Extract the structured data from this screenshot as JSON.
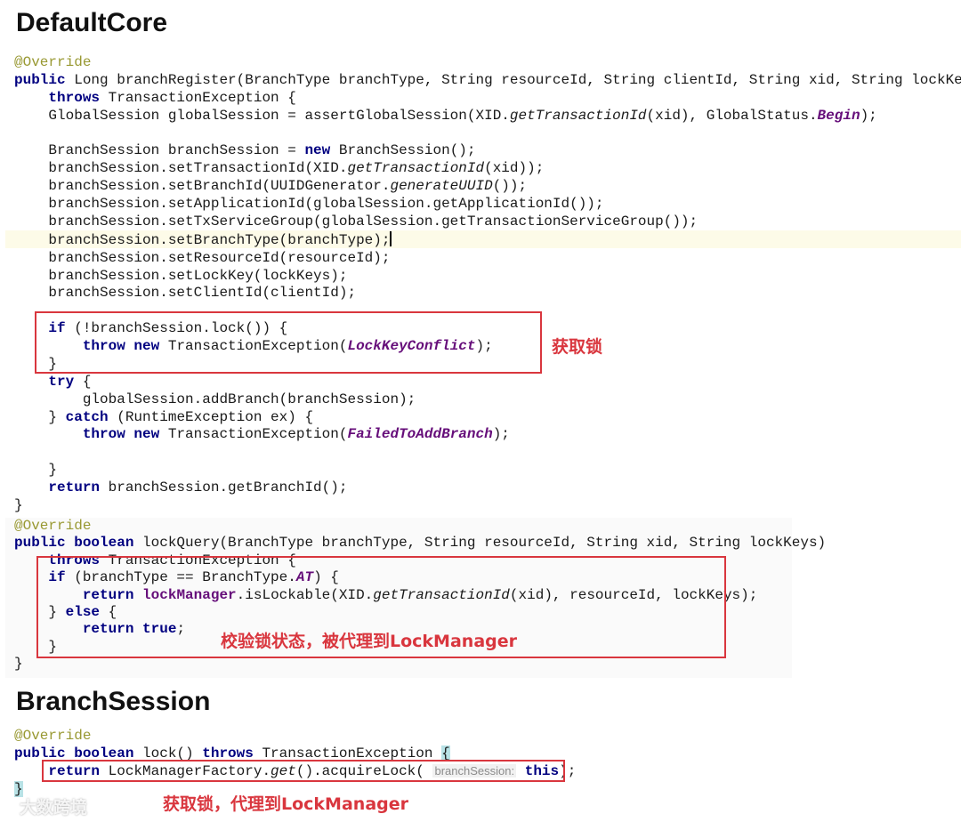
{
  "headings": {
    "default_core": "DefaultCore",
    "branch_session": "BranchSession"
  },
  "annotations": {
    "acquire_lock": "获取锁",
    "check_lock_status": "校验锁状态，被代理到LockManager",
    "acquire_lock_proxy": "获取锁，代理到LockManager"
  },
  "inlay_hint": "branchSession:",
  "watermark": "大数跨境",
  "colors": {
    "annotation_red": "#d9363e",
    "keyword": "#000080",
    "constant": "#660e7a",
    "java_annotation": "#999933"
  }
}
